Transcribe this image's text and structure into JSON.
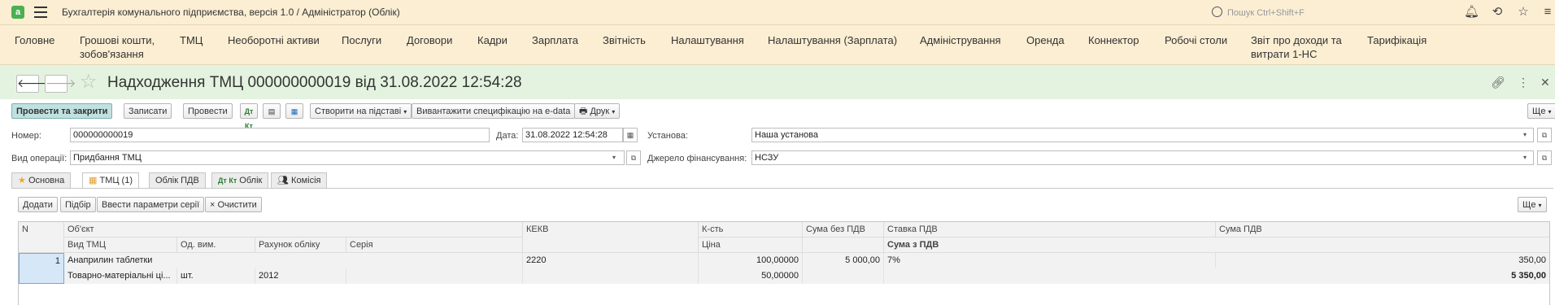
{
  "app": {
    "logo": "a",
    "title": "Бухгалтерія комунального підприємства, версія 1.0 / Адміністратор  (Облік)",
    "search_placeholder": "Пошук Ctrl+Shift+F"
  },
  "menu": [
    "Головне",
    "Грошові кошти, зобов'язання",
    "ТМЦ",
    "Необоротні активи",
    "Послуги",
    "Договори",
    "Кадри",
    "Зарплата",
    "Звітність",
    "Налаштування",
    "Налаштування (Зарплата)",
    "Адміністрування",
    "Оренда",
    "Коннектор",
    "Робочі столи",
    "Звіт про доходи та витрати 1-НС",
    "Тарифікація"
  ],
  "document": {
    "title": "Надходження ТМЦ 000000000019 від 31.08.2022 12:54:28"
  },
  "toolbar": {
    "post_close": "Провести та закрити",
    "save": "Записати",
    "post": "Провести",
    "create_basis": "Створити на підставі",
    "upload_spec": "Вивантажити специфікацію на e-data",
    "print": "Друк",
    "more": "Ще",
    "dtkt_icon_text": "Дт Кт"
  },
  "form": {
    "number_label": "Номер:",
    "number_value": "000000000019",
    "date_label": "Дата:",
    "date_value": "31.08.2022 12:54:28",
    "institution_label": "Установа:",
    "institution_value": "Наша установа",
    "operation_label": "Вид операції:",
    "operation_value": "Придбання ТМЦ",
    "funding_label": "Джерело фінансування:",
    "funding_value": "НСЗУ"
  },
  "tabs": [
    "Основна",
    "ТМЦ (1)",
    "Облік ПДВ",
    "Облік",
    "Комісія"
  ],
  "table_toolbar": {
    "add": "Додати",
    "pick": "Підбір",
    "series": "Ввести параметри серії",
    "clear": "Очистити",
    "more": "Ще"
  },
  "table": {
    "headers_row1": [
      "N",
      "Об'єкт",
      "КЕКВ",
      "К-сть",
      "Сума без ПДВ",
      "Ставка ПДВ",
      "Сума ПДВ"
    ],
    "headers_row2": [
      "Вид ТМЦ",
      "Од. вим.",
      "Рахунок обліку",
      "Серія",
      "Ціна",
      "Сума з ПДВ"
    ],
    "row": {
      "n": "1",
      "object": "Анаприлин таблетки",
      "kekv": "2220",
      "qty": "100,00000",
      "sum_no_vat": "5 000,00",
      "vat_rate": "7%",
      "vat_sum": "350,00",
      "type": "Товарно-матеріальні ці...",
      "unit": "шт.",
      "account": "2012",
      "series": "",
      "price": "50,00000",
      "sum_with_vat": "5 350,00"
    }
  },
  "colors": {
    "titlebar": "#fbeed3",
    "doc_header": "#e4f3e0",
    "primary_button": "#bfe1e0",
    "logo": "#4caf50"
  }
}
